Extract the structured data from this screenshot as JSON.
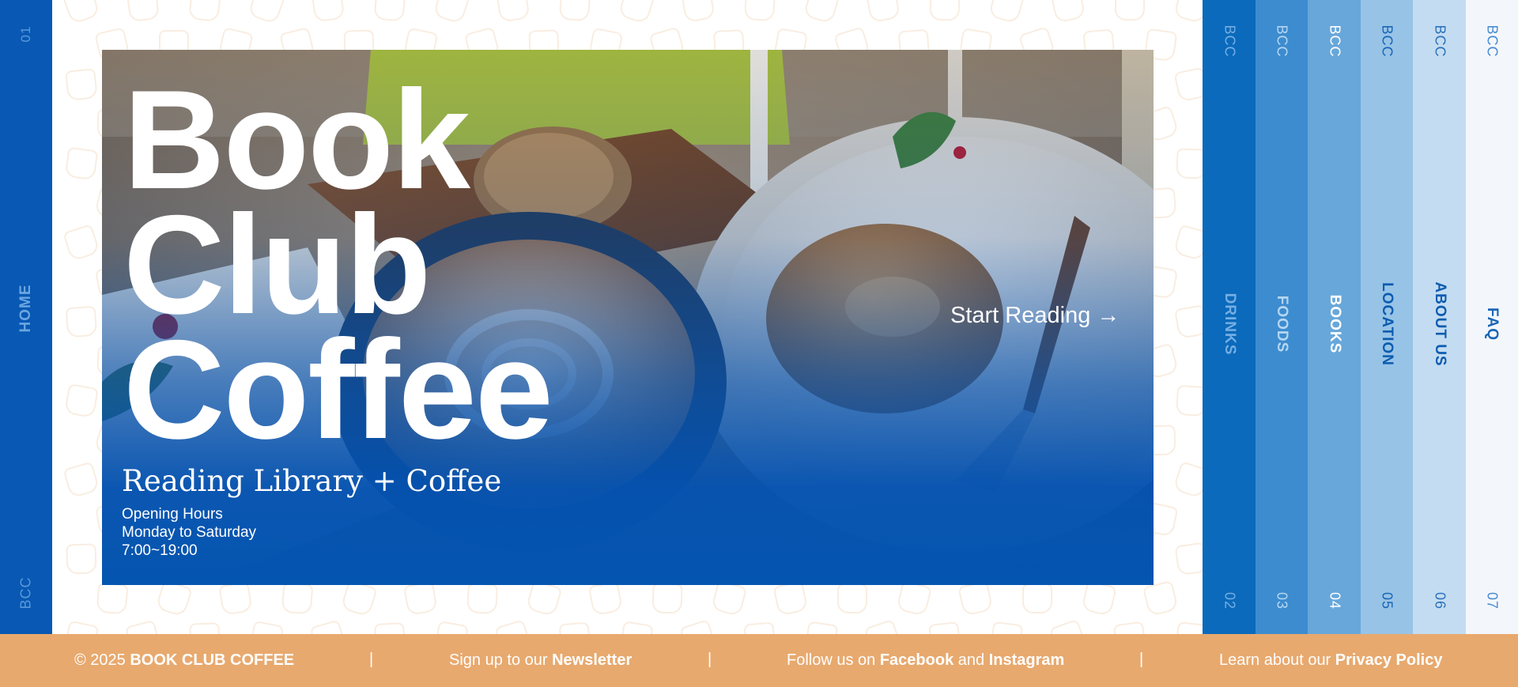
{
  "home": {
    "number": "01",
    "label": "HOME",
    "tag": "BCC"
  },
  "hero": {
    "title_lines": [
      "Book",
      "Club",
      "Coffee"
    ],
    "subtitle": "Reading Library + Coffee",
    "hours": {
      "heading": "Opening Hours",
      "days": "Monday to Saturday",
      "time": "7:00~19:00"
    },
    "cta": "Start Reading →"
  },
  "nav": [
    {
      "tag": "BCC",
      "label": "DRINKS",
      "number": "02",
      "bg": "#0b6abb",
      "text": "#74aee4",
      "tagColor": "#74aee4"
    },
    {
      "tag": "BCC",
      "label": "FOODS",
      "number": "03",
      "bg": "#3d8ccf",
      "text": "#b4d6f2",
      "tagColor": "#b4d6f2"
    },
    {
      "tag": "BCC",
      "label": "BOOKS",
      "number": "04",
      "bg": "#68a7da",
      "text": "#ffffff",
      "tagColor": "#ffffff"
    },
    {
      "tag": "BCC",
      "label": "LOCATION",
      "number": "05",
      "bg": "#97c3e6",
      "text": "#0c5cb0",
      "tagColor": "#1a66b5"
    },
    {
      "tag": "BCC",
      "label": "ABOUT US",
      "number": "06",
      "bg": "#c4dcf1",
      "text": "#0c5cb0",
      "tagColor": "#2a72bd"
    },
    {
      "tag": "BCC",
      "label": "FAQ",
      "number": "07",
      "bg": "#f3f7fc",
      "text": "#1a66b5",
      "tagColor": "#4a8ad0"
    }
  ],
  "footer": {
    "copyright_prefix": "© 2025",
    "brand": "BOOK CLUB COFFEE",
    "separator": "|",
    "newsletter_prefix": "Sign up to our",
    "newsletter": "Newsletter",
    "follow_prefix": "Follow us on",
    "facebook": "Facebook",
    "and": "and",
    "instagram": "Instagram",
    "privacy_prefix": "Learn about our",
    "privacy": "Privacy Policy"
  },
  "colors": {
    "home_bg": "#0858b4",
    "footer_bg": "#e8a96e",
    "hero_overlay": "#0455b0"
  }
}
